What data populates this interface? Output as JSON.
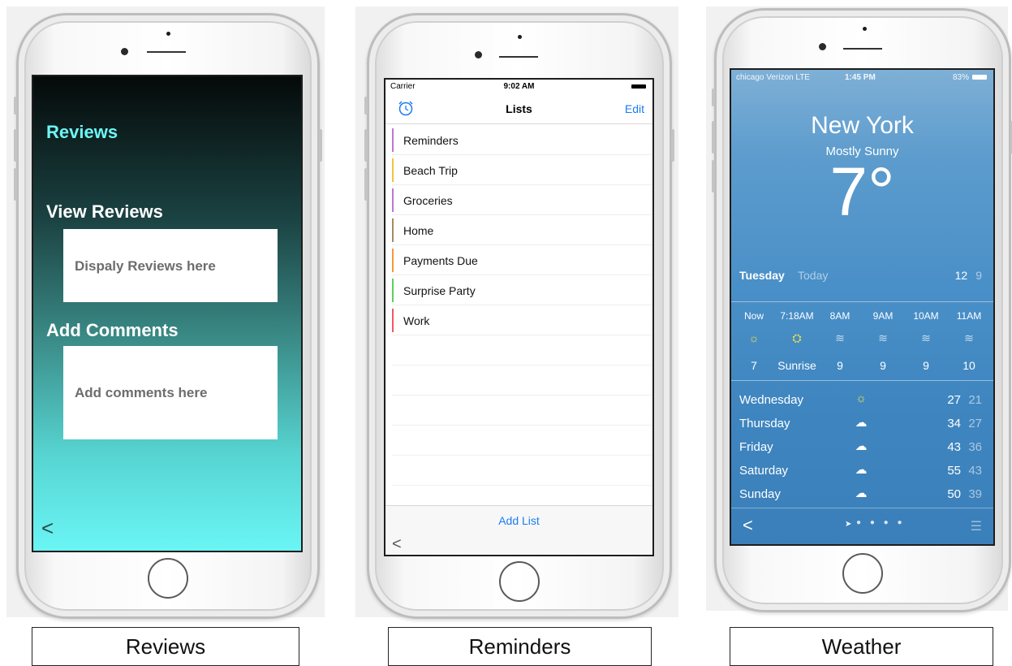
{
  "captions": [
    "Reviews",
    "Reminders",
    "Weather"
  ],
  "reviews": {
    "title": "Reviews",
    "view_heading": "View Reviews",
    "view_box_text": "Dispaly Reviews here",
    "add_heading": "Add Comments",
    "add_box_text": "Add comments here",
    "back_glyph": "<"
  },
  "reminders": {
    "status": {
      "carrier": "Carrier",
      "time": "9:02 AM"
    },
    "nav": {
      "title": "Lists",
      "edit": "Edit"
    },
    "lists": [
      {
        "label": "Reminders",
        "color": "#c373d6"
      },
      {
        "label": "Beach Trip",
        "color": "#f2c33e"
      },
      {
        "label": "Groceries",
        "color": "#c373d6"
      },
      {
        "label": "Home",
        "color": "#a68a62"
      },
      {
        "label": "Payments Due",
        "color": "#f29a3c"
      },
      {
        "label": "Surprise Party",
        "color": "#5fcf5a"
      },
      {
        "label": "Work",
        "color": "#ee5a63"
      }
    ],
    "add_list": "Add List",
    "back_glyph": "<"
  },
  "weather": {
    "status": {
      "carrier": "chicago Verizon  LTE",
      "time": "1:45 PM",
      "battery": "83%"
    },
    "city": "New York",
    "condition": "Mostly Sunny",
    "temp": "7°",
    "today": {
      "day": "Tuesday",
      "label": "Today",
      "high": "12",
      "low": "9"
    },
    "hourly": [
      {
        "time": "Now",
        "icon": "sun-icon",
        "temp": "7"
      },
      {
        "time": "7:18AM",
        "icon": "sunrise-icon",
        "temp": "Sunrise"
      },
      {
        "time": "8AM",
        "icon": "wind-icon",
        "temp": "9"
      },
      {
        "time": "9AM",
        "icon": "wind-icon",
        "temp": "9"
      },
      {
        "time": "10AM",
        "icon": "wind-icon",
        "temp": "9"
      },
      {
        "time": "11AM",
        "icon": "wind-icon",
        "temp": "10"
      }
    ],
    "daily": [
      {
        "day": "Wednesday",
        "icon": "sun-icon",
        "high": "27",
        "low": "21"
      },
      {
        "day": "Thursday",
        "icon": "cloud-icon",
        "high": "34",
        "low": "27"
      },
      {
        "day": "Friday",
        "icon": "cloud-icon",
        "high": "43",
        "low": "36"
      },
      {
        "day": "Saturday",
        "icon": "cloud-icon",
        "high": "55",
        "low": "43"
      },
      {
        "day": "Sunday",
        "icon": "cloud-icon",
        "high": "50",
        "low": "39"
      }
    ],
    "back_glyph": "<"
  }
}
